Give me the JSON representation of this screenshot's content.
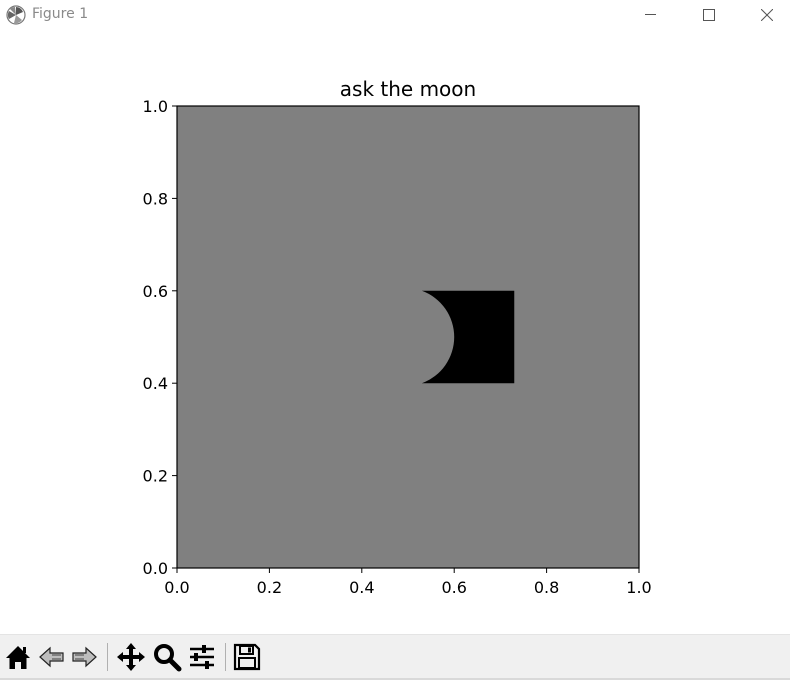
{
  "window": {
    "title": "Figure 1",
    "icons": {
      "app": "matplotlib-logo-icon",
      "minimize": "minimize-icon",
      "maximize": "maximize-icon",
      "close": "close-icon"
    }
  },
  "chart_data": {
    "type": "patches",
    "title": "ask the moon",
    "xlabel": "",
    "ylabel": "",
    "xlim": [
      0,
      1
    ],
    "ylim": [
      0,
      1
    ],
    "xticks": [
      "0.0",
      "0.2",
      "0.4",
      "0.6",
      "0.8",
      "1.0"
    ],
    "yticks": [
      "0.0",
      "0.2",
      "0.4",
      "0.6",
      "0.8",
      "1.0"
    ],
    "grid": false,
    "axes_facecolor": "#808080",
    "shape": {
      "description": "crescent",
      "color": "#000000",
      "x_left": 0.53,
      "x_right": 0.73,
      "y_bottom": 0.4,
      "y_top": 0.6,
      "notch_depth": 0.07
    }
  },
  "toolbar": {
    "buttons": [
      {
        "name": "home-button",
        "icon": "home-icon"
      },
      {
        "name": "back-button",
        "icon": "back-arrow-icon"
      },
      {
        "name": "forward-button",
        "icon": "forward-arrow-icon"
      },
      {
        "name": "pan-button",
        "icon": "pan-icon"
      },
      {
        "name": "zoom-button",
        "icon": "zoom-icon"
      },
      {
        "name": "configure-subplots-button",
        "icon": "sliders-icon"
      },
      {
        "name": "save-button",
        "icon": "save-icon"
      }
    ]
  }
}
